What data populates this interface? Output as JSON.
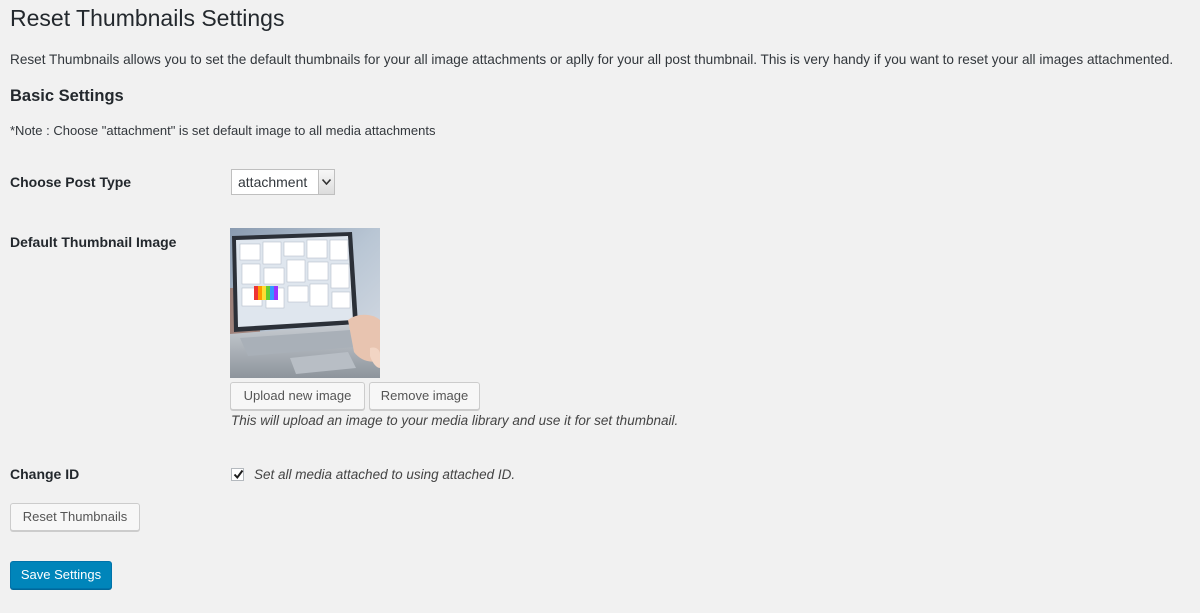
{
  "page": {
    "title": "Reset Thumbnails Settings",
    "intro": "Reset Thumbnails allows you to set the default thumbnails for your all image attachments or aplly for your all post thumbnail. This is very handy if you want to reset your all images attachmented."
  },
  "basic_settings": {
    "heading": "Basic Settings",
    "note": "*Note : Choose \"attachment\" is set default image to all media attachments"
  },
  "post_type": {
    "label": "Choose Post Type",
    "selected": "attachment"
  },
  "thumbnail": {
    "label": "Default Thumbnail Image",
    "upload_label": "Upload new image",
    "remove_label": "Remove image",
    "help": "This will upload an image to your media library and use it for set thumbnail."
  },
  "change_id": {
    "label": "Change ID",
    "checked": true,
    "checkbox_label": "Set all media attached to using attached ID."
  },
  "actions": {
    "reset_label": "Reset Thumbnails",
    "save_label": "Save Settings"
  },
  "colors": {
    "background": "#f1f1f1",
    "primary": "#0085ba",
    "text": "#23282d"
  }
}
